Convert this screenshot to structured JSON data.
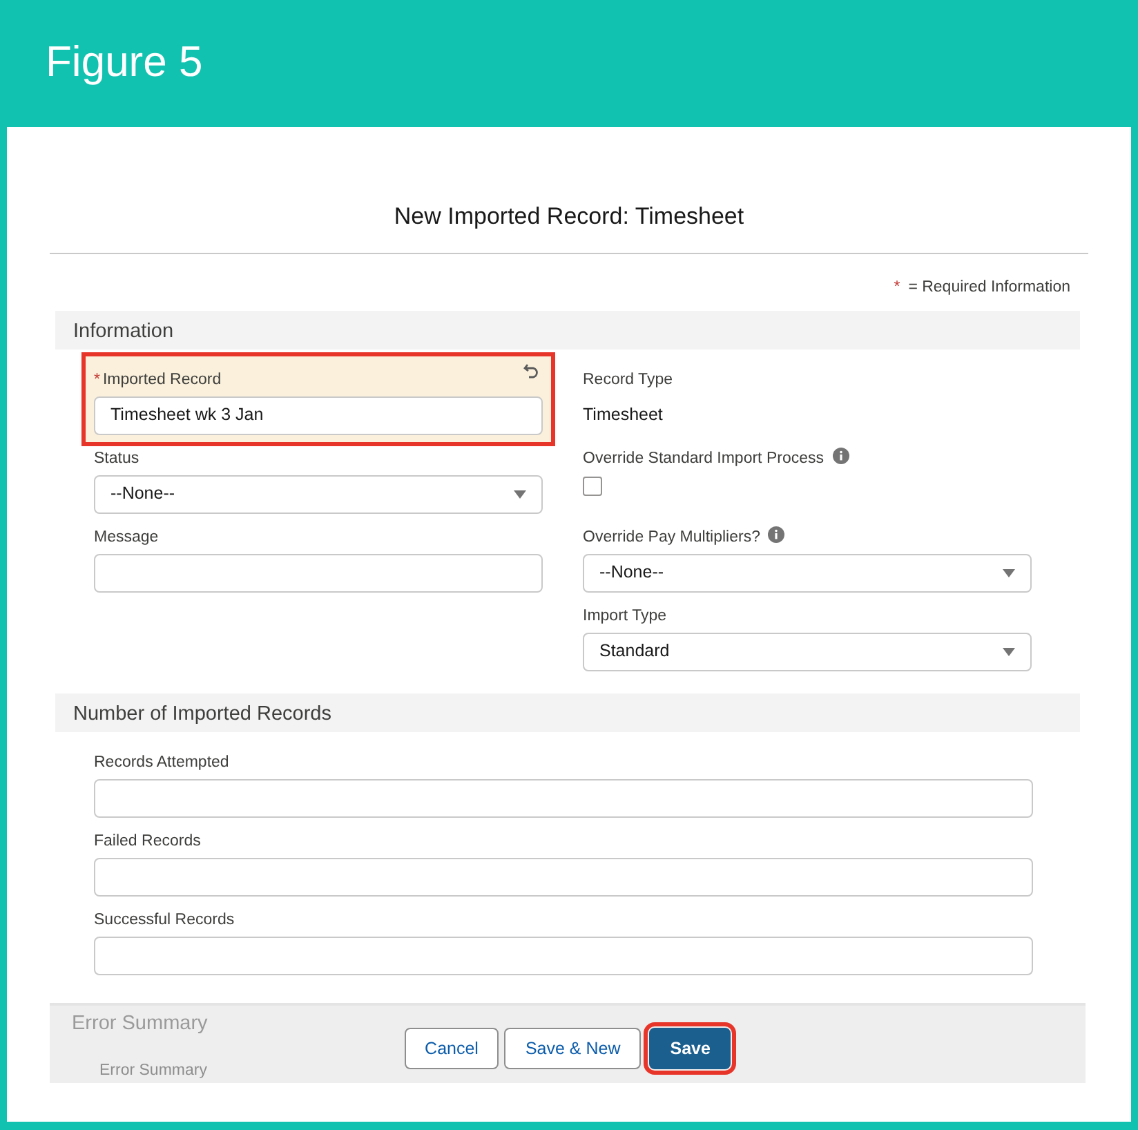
{
  "figure": {
    "title": "Figure 5"
  },
  "modal": {
    "title": "New Imported Record: Timesheet",
    "required_mark": "*",
    "required_note": "= Required Information"
  },
  "sections": [
    {
      "title": "Information",
      "columns": [
        [
          {
            "kind": "text",
            "label": "Imported Record",
            "required": true,
            "changed": true,
            "highlighted": true,
            "value": "Timesheet wk 3 Jan"
          },
          {
            "kind": "select",
            "label": "Status",
            "value": "--None--"
          },
          {
            "kind": "text",
            "label": "Message"
          }
        ],
        [
          {
            "kind": "readonly",
            "label": "Record Type",
            "value": "Timesheet"
          },
          {
            "kind": "checkbox",
            "label": "Override Standard Import Process",
            "info": true,
            "checked": false
          },
          {
            "kind": "select",
            "label": "Override Pay Multipliers?",
            "info": true,
            "value": "--None--"
          },
          {
            "kind": "select",
            "label": "Import Type",
            "value": "Standard"
          }
        ]
      ]
    },
    {
      "title": "Number of Imported Records",
      "columns": [
        [
          {
            "kind": "text",
            "label": "Records Attempted"
          },
          {
            "kind": "text",
            "label": "Failed Records"
          },
          {
            "kind": "text",
            "label": "Successful Records"
          }
        ]
      ]
    }
  ],
  "footer": {
    "covered_section": "Error Summary",
    "covered_label": "Error Summary",
    "buttons": [
      {
        "label": "Cancel",
        "kind": "neutral",
        "highlighted": false
      },
      {
        "label": "Save & New",
        "kind": "neutral",
        "highlighted": false
      },
      {
        "label": "Save",
        "kind": "brand",
        "highlighted": true
      }
    ]
  }
}
